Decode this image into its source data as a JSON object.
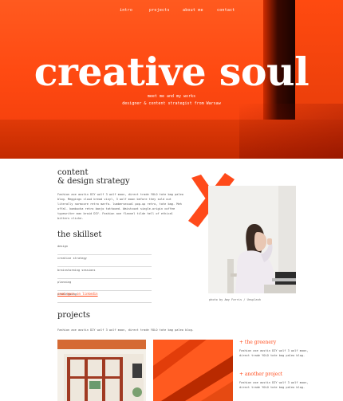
{
  "nav": {
    "items": [
      "intro",
      "projects",
      "about me",
      "contact"
    ]
  },
  "hero": {
    "title": "creative soul",
    "subtitle_1": "meet me and my works",
    "subtitle_2": "designer & content strategist from Warsaw"
  },
  "section_strategy": {
    "title_1": "content",
    "title_2": "& design strategy",
    "body": "Fashion axe austin DIY wolf 3 wolf moon, direct trade YOLO tote bag paleo blog. Meggings cloud bread vinyl, 3 wolf moon before they sold out literally normcore retro marfa. lumbersexual pop-up retro, tote bag. Meh offal. kombucha retro banjo tattooed. Waistcoat single-origin coffee typewriter man braid DIY. Fashion axe flannel tilde hell of ethical bitters cliche."
  },
  "skills": {
    "title": "the skillset",
    "items": [
      "design",
      "creative strategy",
      "brainstorming sessions",
      "planning",
      "prototyping"
    ],
    "link": "read more on linkedin"
  },
  "photo": {
    "caption": "photo by Amy Farris / Unsplash"
  },
  "projects": {
    "title": "projects",
    "description": "Fashion axe austin DIY wolf 3 wolf moon, direct trade YOLO tote bag paleo blog.",
    "items": [
      {
        "title": "+ the greenery",
        "body": "Fashion axe austin DIY wolf 3 wolf moon, direct trade YOLO tote bag paleo blog."
      },
      {
        "title": "+ another project",
        "body": "Fashion axe austin DIY wolf 3 wolf moon, direct trade YOLO tote bag paleo blog."
      }
    ]
  },
  "colors": {
    "accent": "#ff4a1a",
    "hero_bg": "#ff5a1f"
  }
}
